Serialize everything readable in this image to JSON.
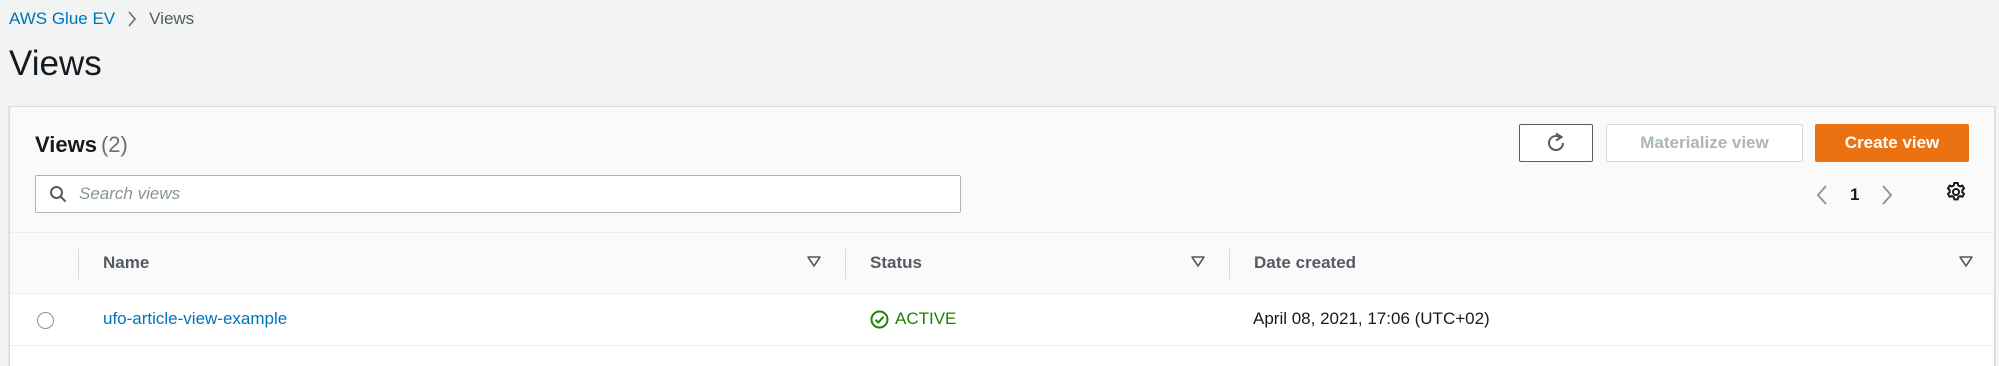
{
  "breadcrumb": {
    "root": "AWS Glue EV",
    "current": "Views"
  },
  "page": {
    "title": "Views"
  },
  "panel": {
    "title": "Views",
    "count": "(2)",
    "buttons": {
      "refresh_icon": "refresh-icon",
      "materialize_label": "Materialize view",
      "create_label": "Create view"
    },
    "search": {
      "placeholder": "Search views",
      "value": ""
    },
    "pagination": {
      "current_page": "1"
    }
  },
  "table": {
    "columns": [
      "Name",
      "Status",
      "Date created"
    ],
    "rows": [
      {
        "name": "ufo-article-view-example",
        "status": "ACTIVE",
        "date_created": "April 08, 2021, 17:06 (UTC+02)"
      }
    ]
  },
  "colors": {
    "link": "#0073bb",
    "primary_button": "#ec7211",
    "status_active": "#1d8102"
  }
}
